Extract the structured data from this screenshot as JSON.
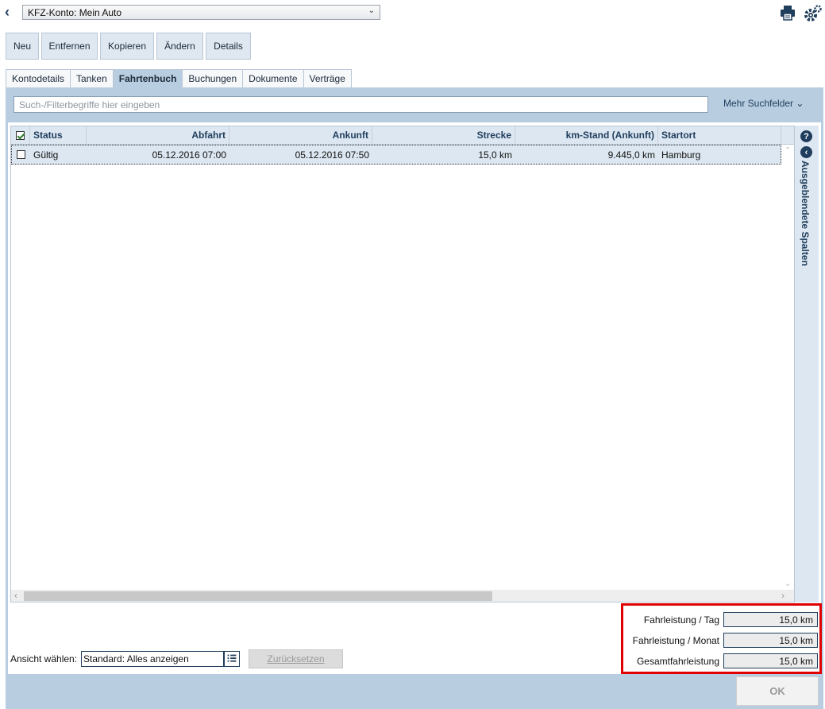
{
  "header": {
    "account_select": "KFZ-Konto: Mein Auto"
  },
  "toolbar": {
    "buttons": [
      "Neu",
      "Entfernen",
      "Kopieren",
      "Ändern",
      "Details"
    ]
  },
  "tabs": [
    {
      "label": "Kontodetails",
      "active": false
    },
    {
      "label": "Tanken",
      "active": false
    },
    {
      "label": "Fahrtenbuch",
      "active": true
    },
    {
      "label": "Buchungen",
      "active": false
    },
    {
      "label": "Dokumente",
      "active": false
    },
    {
      "label": "Verträge",
      "active": false
    }
  ],
  "search": {
    "placeholder": "Such-/Filterbegriffe hier eingeben",
    "more_fields": "Mehr Suchfelder"
  },
  "table": {
    "columns": [
      "Status",
      "Abfahrt",
      "Ankunft",
      "Strecke",
      "km-Stand (Ankunft)",
      "Startort"
    ],
    "rows": [
      {
        "status": "Gültig",
        "abfahrt": "05.12.2016 07:00",
        "ankunft": "05.12.2016 07:50",
        "strecke": "15,0 km",
        "km_stand": "9.445,0 km",
        "startort": "Hamburg"
      }
    ]
  },
  "side_panel": {
    "label": "Ausgeblendete Spalten"
  },
  "summary": {
    "items": [
      {
        "label": "Fahrleistung / Tag",
        "value": "15,0 km"
      },
      {
        "label": "Fahrleistung / Monat",
        "value": "15,0 km"
      },
      {
        "label": "Gesamtfahrleistung",
        "value": "15,0 km"
      }
    ]
  },
  "view": {
    "label": "Ansicht wählen:",
    "value": "Standard: Alles anzeigen",
    "reset": "Zurücksetzen"
  },
  "footer": {
    "ok": "OK"
  },
  "colors": {
    "accent": "#1f3d5c",
    "panel": "#b8cde0",
    "highlight_border": "#e00000"
  }
}
